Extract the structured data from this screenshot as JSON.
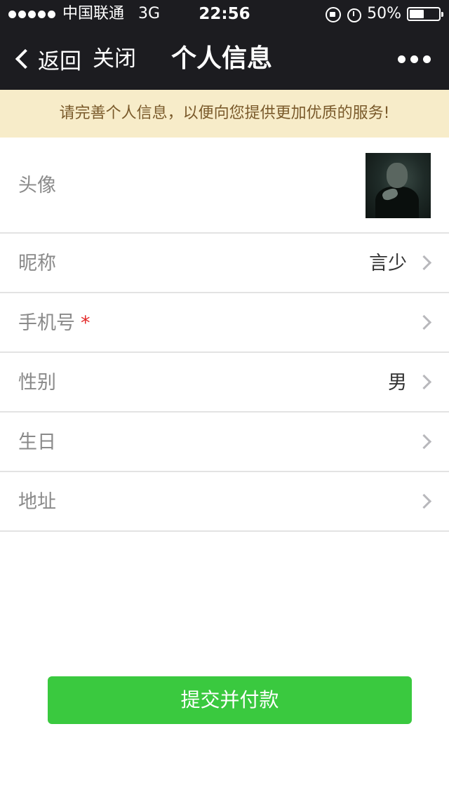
{
  "status_bar": {
    "carrier": "中国联通",
    "network": "3G",
    "time": "22:56",
    "battery": "50%",
    "battery_level": 0.5
  },
  "nav": {
    "back_label": "返回",
    "close_label": "关闭",
    "title": "个人信息"
  },
  "notice": "请完善个人信息，以便向您提供更加优质的服务!",
  "rows": [
    {
      "label": "头像"
    },
    {
      "label": "昵称",
      "value": "言少"
    },
    {
      "label": "手机号",
      "required_mark": "*"
    },
    {
      "label": "性别",
      "value": "男"
    },
    {
      "label": "生日"
    },
    {
      "label": "地址"
    }
  ],
  "submit_label": "提交并付款",
  "colors": {
    "bar_bg": "#1c1c20",
    "notice_bg": "#f7ecc9",
    "notice_text": "#7a5a2b",
    "primary_button": "#3ac93f",
    "required": "#e32a2a"
  }
}
